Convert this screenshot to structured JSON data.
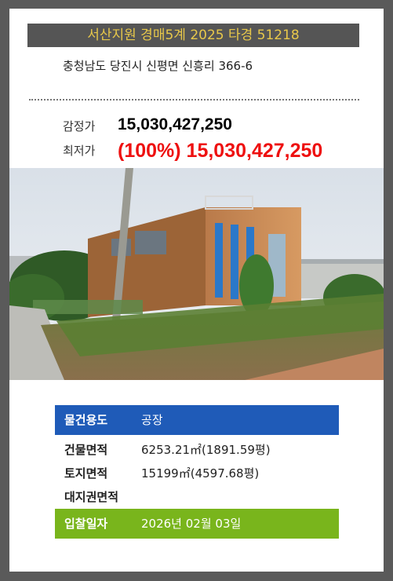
{
  "header": {
    "title": "서산지원 경매5계 2025 타경 51218",
    "address": "충청남도 당진시 신평면 신흥리 366-6"
  },
  "prices": {
    "appraisal_label": "감정가",
    "appraisal_value": "15,030,427,250",
    "minimum_label": "최저가",
    "minimum_value": "(100%) 15,030,427,250"
  },
  "colors": {
    "title_bar": "#555555",
    "title_text": "#e8c84a",
    "minimum_price": "#ee1010",
    "usage_row": "#1f5bb8",
    "bid_date_row": "#79b51c"
  },
  "details": {
    "usage_label": "물건용도",
    "usage_value": "공장",
    "building_area_label": "건물면적",
    "building_area_value": "6253.21㎡(1891.59평)",
    "land_area_label": "토지면적",
    "land_area_value": "15199㎡(4597.68평)",
    "land_right_label": "대지권면적",
    "land_right_value": "",
    "bid_date_label": "입찰일자",
    "bid_date_value": "2026년 02월 03일"
  }
}
